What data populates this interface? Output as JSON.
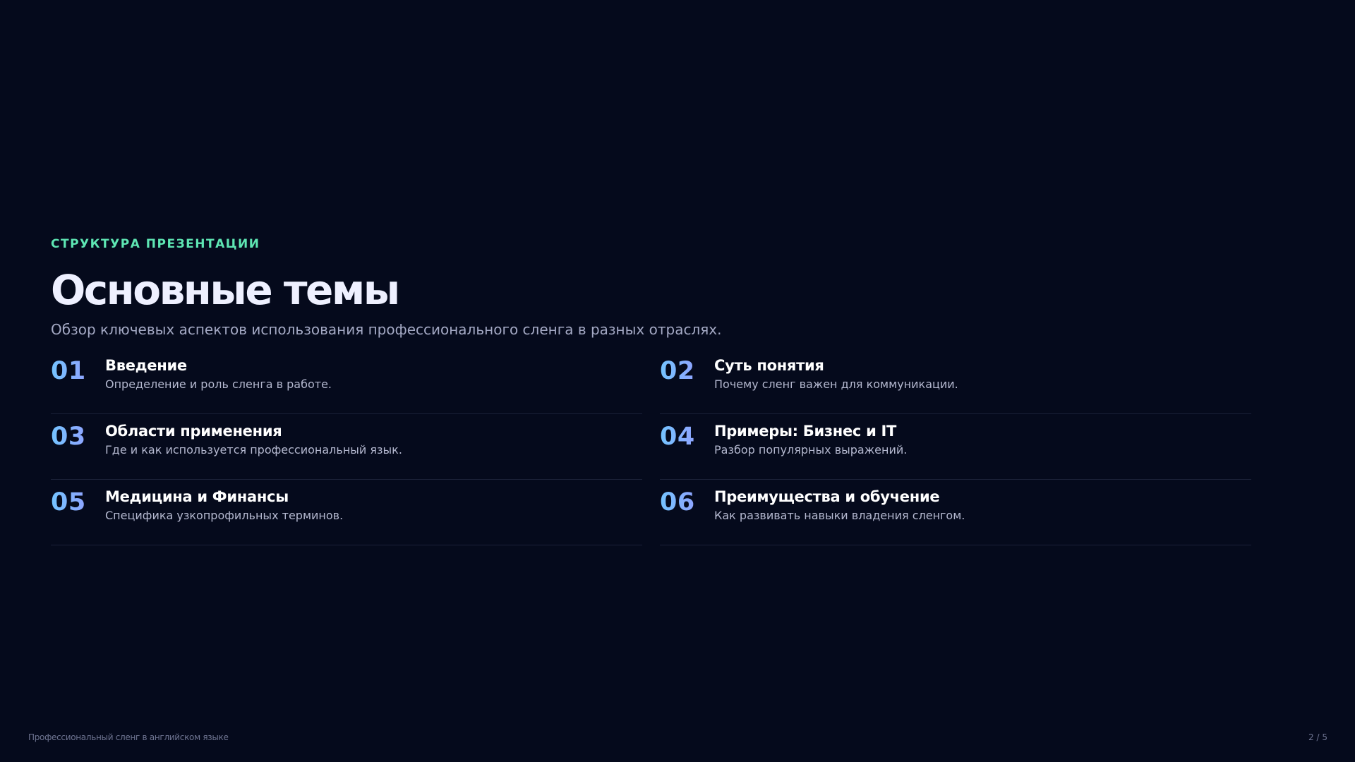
{
  "section_label": "СТРУКТУРА ПРЕЗЕНТАЦИИ",
  "title": "Основные темы",
  "subtitle": "Обзор ключевых аспектов использования профессионального сленга в разных отраслях.",
  "topics": [
    {
      "number": "01",
      "title": "Введение",
      "description": "Определение и роль сленга в работе."
    },
    {
      "number": "02",
      "title": "Суть понятия",
      "description": "Почему сленг важен для коммуникации."
    },
    {
      "number": "03",
      "title": "Области применения",
      "description": "Где и как используется профессиональный язык."
    },
    {
      "number": "04",
      "title": "Примеры: Бизнес и IT",
      "description": "Разбор популярных выражений."
    },
    {
      "number": "05",
      "title": "Медицина и Финансы",
      "description": "Специфика узкопрофильных терминов."
    },
    {
      "number": "06",
      "title": "Преимущества и обучение",
      "description": "Как развивать навыки владения сленгом."
    }
  ],
  "footer": {
    "presentation_title": "Профессиональный сленг в английском языке",
    "page_indicator": "2 / 5"
  },
  "colors": {
    "background": "#050a1c",
    "accent": "#5ee6b3",
    "number_gradient_start": "#74c4ff",
    "number_gradient_end": "#9d93ff"
  }
}
